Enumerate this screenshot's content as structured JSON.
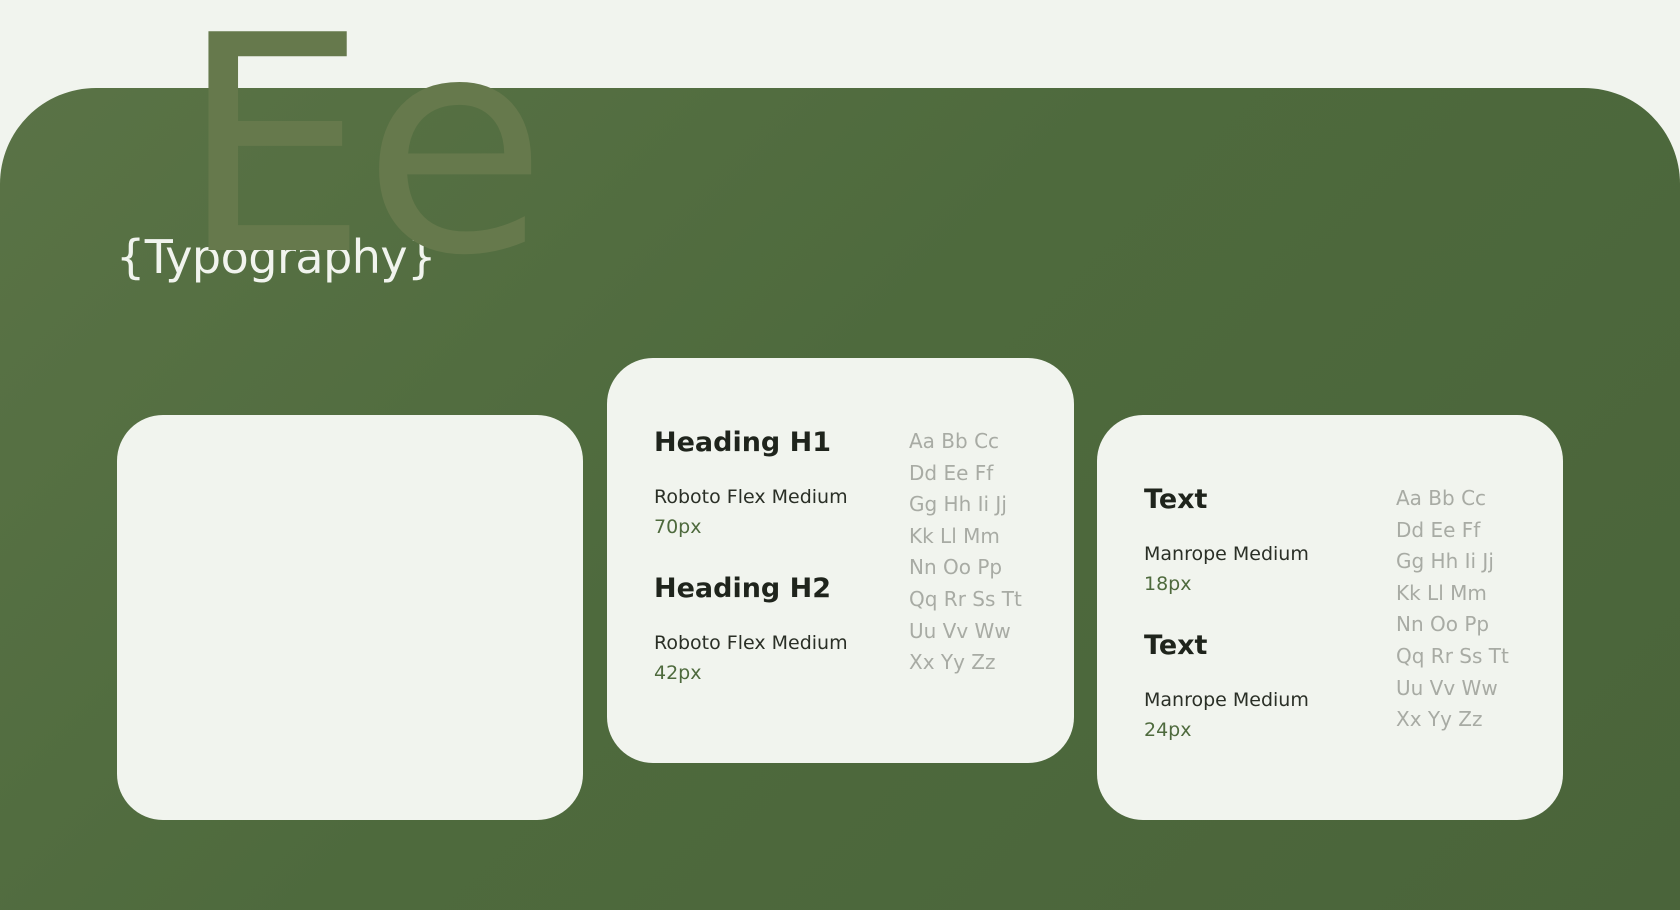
{
  "section": {
    "title": "{Typography}"
  },
  "glyph_card": {
    "glyph": "Ee",
    "glyph_color": "#66794c"
  },
  "headings_card": {
    "styles": [
      {
        "name": "Heading H1",
        "font": "Roboto Flex Medium",
        "size": "70px"
      },
      {
        "name": "Heading H2",
        "font": "Roboto Flex Medium",
        "size": "42px"
      }
    ],
    "alphabet": [
      "Aa Bb Cc",
      "Dd Ee Ff",
      "Gg Hh Ii Jj",
      "Kk Ll Mm",
      "Nn Oo Pp",
      "Qq Rr Ss Tt",
      "Uu Vv Ww",
      "Xx Yy Zz"
    ]
  },
  "text_card": {
    "styles": [
      {
        "name": "Text",
        "font": "Manrope Medium",
        "size": "18px"
      },
      {
        "name": "Text",
        "font": "Manrope Medium",
        "size": "24px"
      }
    ],
    "alphabet": [
      "Aa Bb Cc",
      "Dd Ee Ff",
      "Gg Hh Ii Jj",
      "Kk Ll Mm",
      "Nn Oo Pp",
      "Qq Rr Ss Tt",
      "Uu Vv Ww",
      "Xx Yy Zz"
    ]
  },
  "colors": {
    "background": "#f1f4ee",
    "panel": "#4e6a3d",
    "card": "#f1f4ee",
    "accent": "#4e6a3d",
    "muted_text": "#a8aba4"
  }
}
